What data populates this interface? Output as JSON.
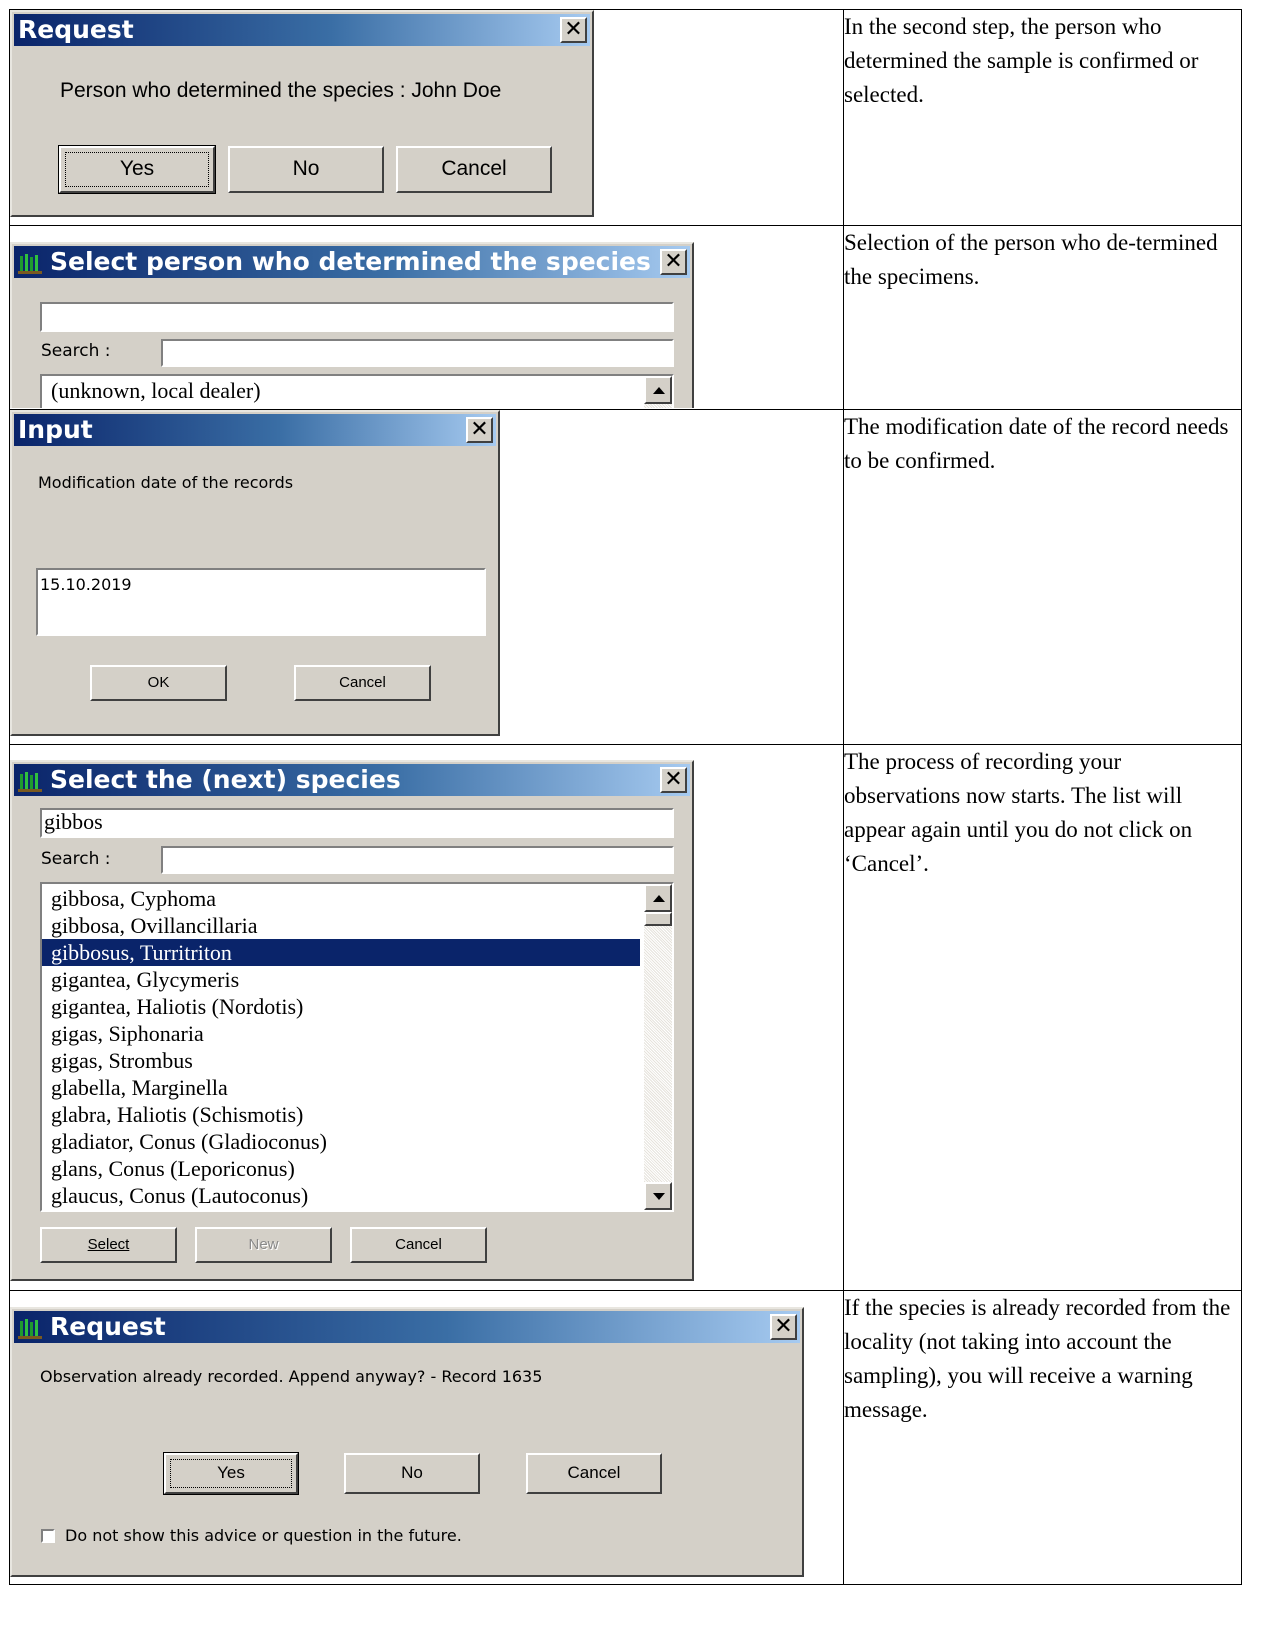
{
  "rows": [
    {
      "description": "In the second step, the person who determined the sample is confirmed or selected.",
      "dialog": {
        "title": "Request",
        "message": "Person who determined the species : John Doe",
        "buttons": {
          "yes": "Yes",
          "no": "No",
          "cancel": "Cancel"
        }
      }
    },
    {
      "description": "Selection of the person who de-termined the specimens.",
      "dialog": {
        "title": "Select person who determined the species",
        "top_field_value": "",
        "search_label": "Search :",
        "search_value": "",
        "list_items": [
          "(unknown, local dealer)"
        ]
      }
    },
    {
      "description": "The modification date of the record needs to be confirmed.",
      "dialog": {
        "title": "Input",
        "prompt": "Modification date of the records",
        "value": "15.10.2019",
        "buttons": {
          "ok": "OK",
          "cancel": "Cancel"
        }
      }
    },
    {
      "description": "The process of recording your observations now starts. The list will appear again until you do not click on ‘Cancel’.",
      "dialog": {
        "title": "Select the (next) species",
        "top_field_value": "gibbos",
        "search_label": "Search :",
        "search_value": "",
        "list_items": [
          "gibbosa, Cyphoma",
          "gibbosa, Ovillancillaria",
          "gibbosus, Turritriton",
          "gigantea, Glycymeris",
          "gigantea, Haliotis (Nordotis)",
          "gigas, Siphonaria",
          "gigas, Strombus",
          "glabella, Marginella",
          "glabra, Haliotis (Schismotis)",
          "gladiator, Conus (Gladioconus)",
          "glans, Conus (Leporiconus)",
          "glaucus, Conus (Lautoconus)"
        ],
        "selected_item": "gibbosus, Turritriton",
        "buttons": {
          "select": "Select",
          "new": "New",
          "cancel": "Cancel"
        }
      }
    },
    {
      "description": "If the species is already recorded from the locality (not taking into account the sampling), you will receive a warning message.",
      "dialog": {
        "title": "Request",
        "message": "Observation already recorded. Append anyway? - Record 1635",
        "buttons": {
          "yes": "Yes",
          "no": "No",
          "cancel": "Cancel"
        },
        "checkbox_label": "Do not show this advice or question in the future.",
        "checkbox_checked": false
      }
    }
  ],
  "icons": {
    "app": "forest-icon",
    "close": "close-icon"
  },
  "colors": {
    "titlebar_start": "#0a246a",
    "titlebar_end": "#a6caf0",
    "dialog_bg": "#d4d0c8",
    "selection": "#0a246a"
  }
}
